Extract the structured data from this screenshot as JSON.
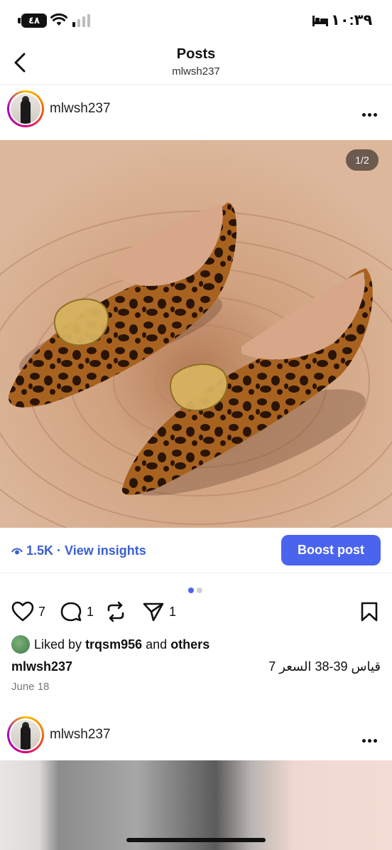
{
  "status_bar": {
    "battery": "٤٨",
    "time": "١٠:٣٩"
  },
  "header": {
    "title": "Posts",
    "subtitle": "mlwsh237"
  },
  "post": {
    "username": "mlwsh237",
    "image_counter": "1/2",
    "insights": {
      "views": "1.5K",
      "separator": "·",
      "label": "View insights"
    },
    "boost_label": "Boost post",
    "carousel": {
      "count": 2,
      "active": 1
    },
    "actions": {
      "likes": "7",
      "comments": "1",
      "reposts": "",
      "shares": "1"
    },
    "liked_by": {
      "prefix": "Liked by",
      "user": "trqsm956",
      "and": "and",
      "others": "others"
    },
    "caption_user": "mlwsh237",
    "caption_text": "قياس 39-38 السعر 7",
    "date": "June 18"
  },
  "next_post": {
    "username": "mlwsh237"
  },
  "colors": {
    "accent": "#4a64ee",
    "link": "#3b5fd0",
    "dot_active": "#4a64ee",
    "dot_inactive": "#d0d0d0"
  }
}
